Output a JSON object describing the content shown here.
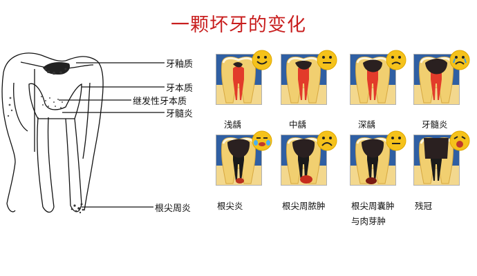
{
  "title": "一颗坏牙的变化",
  "diagram_labels": {
    "enamel": "牙釉质",
    "dentin": "牙本质",
    "secondary_dentin": "继发性牙本质",
    "pulpitis": "牙髓炎",
    "periapical": "根尖周炎"
  },
  "stages": [
    {
      "label": "浅龋",
      "face": "happy"
    },
    {
      "label": "中龋",
      "face": "neutral"
    },
    {
      "label": "深龋",
      "face": "sad"
    },
    {
      "label": "牙髓炎",
      "face": "crying"
    },
    {
      "label": "根尖炎",
      "face": "sweating"
    },
    {
      "label": "根尖周脓肿",
      "face": "frown"
    },
    {
      "label": "根尖周囊肿",
      "label2": "与肉芽肿",
      "face": "neutral"
    },
    {
      "label": "残冠",
      "face": "screaming"
    }
  ],
  "colors": {
    "title": "#c81e1e",
    "panel_bg": "#2f5fa3",
    "pulp": "#e23b2a",
    "dentin": "#f1cf70",
    "face": "#f5c21b"
  }
}
